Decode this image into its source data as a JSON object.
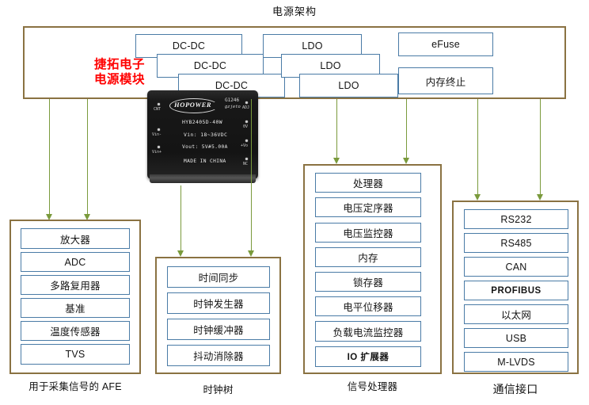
{
  "title": "电源架构",
  "brand": {
    "line1": "捷拓电子",
    "line2": "电源模块"
  },
  "colors": {
    "group_border": "#8a7242",
    "box_border": "#4a7ba6",
    "arrow": "#7a9a3c",
    "brand_text": "#ff0000"
  },
  "power_bus": {
    "name": "电源架构",
    "boxes": [
      {
        "label": "DC-DC"
      },
      {
        "label": "DC-DC"
      },
      {
        "label": "DC-DC"
      },
      {
        "label": "LDO"
      },
      {
        "label": "LDO"
      },
      {
        "label": "LDO"
      },
      {
        "label": "eFuse"
      },
      {
        "label": "内存终止"
      }
    ]
  },
  "module": {
    "brand": "HOPOWER",
    "code": "G1246",
    "sub": "gzjeto",
    "model": "HYB2405D-40W",
    "vin": "Vin: 18~36VDC",
    "vout": "Vout: 5V#5.00A",
    "origin": "MADE IN CHINA",
    "pins_left": [
      "CNT",
      "Vin-",
      "Vin+"
    ],
    "pins_right": [
      "ADJ",
      "0V",
      "+Vo",
      "NC"
    ]
  },
  "groups": [
    {
      "key": "afe",
      "label": "用于采集信号的 AFE",
      "items": [
        {
          "label": "放大器"
        },
        {
          "label": "ADC"
        },
        {
          "label": "多路复用器"
        },
        {
          "label": "基准"
        },
        {
          "label": "温度传感器"
        },
        {
          "label": "TVS"
        }
      ]
    },
    {
      "key": "clock",
      "label": "时钟树",
      "items": [
        {
          "label": "时间同步"
        },
        {
          "label": "时钟发生器"
        },
        {
          "label": "时钟缓冲器"
        },
        {
          "label": "抖动消除器"
        }
      ]
    },
    {
      "key": "sig",
      "label": "信号处理器",
      "items": [
        {
          "label": "处理器"
        },
        {
          "label": "电压定序器"
        },
        {
          "label": "电压监控器"
        },
        {
          "label": "内存"
        },
        {
          "label": "锁存器"
        },
        {
          "label": "电平位移器"
        },
        {
          "label": "负载电流监控器"
        },
        {
          "label": "IO 扩展器"
        }
      ]
    },
    {
      "key": "comm",
      "label": "通信接口",
      "items": [
        {
          "label": "RS232"
        },
        {
          "label": "RS485"
        },
        {
          "label": "CAN"
        },
        {
          "label": "PROFIBUS"
        },
        {
          "label": "以太网"
        },
        {
          "label": "USB"
        },
        {
          "label": "M-LVDS"
        }
      ]
    }
  ]
}
